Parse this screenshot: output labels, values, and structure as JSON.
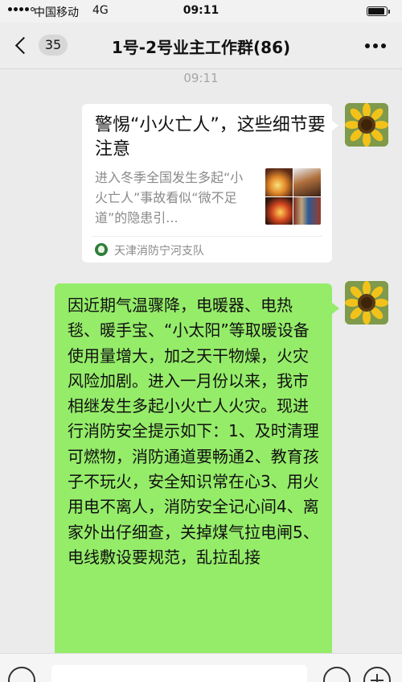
{
  "status_bar": {
    "carrier": "中国移动",
    "network": "4G",
    "time": "09:11",
    "battery_level": 0.9
  },
  "nav": {
    "unread_count": "35",
    "title": "1号-2号业主工作群(86)",
    "back_icon": "chevron-left-icon",
    "more_icon": "more-dots-icon"
  },
  "chat": {
    "timestamp": "09:11",
    "messages": [
      {
        "type": "link_card",
        "title": "警惕“小火亡人”，这些细节要注意",
        "description": "进入冬季全国发生多起“小火亡人”事故看似“微不足道”的隐患引...",
        "source": "天津消防宁河支队"
      },
      {
        "type": "text",
        "text": "因近期气温骤降，电暖器、电热毯、暖手宝、“小太阳”等取暖设备使用量增大，加之天干物燥，火灾风险加剧。进入一月份以来，我市相继发生多起小火亡人火灾。现进行消防安全提示如下：1、及时清理可燃物，消防通道要畅通2、教育孩子不玩火，安全知识常在心3、用火用电不离人，消防安全记心间4、离家外出仔细查，关掉煤气拉电闸5、电线敷设要规范，乱拉乱接"
      }
    ]
  },
  "colors": {
    "bubble_green": "#95ec69",
    "chat_background": "#ebebeb"
  }
}
